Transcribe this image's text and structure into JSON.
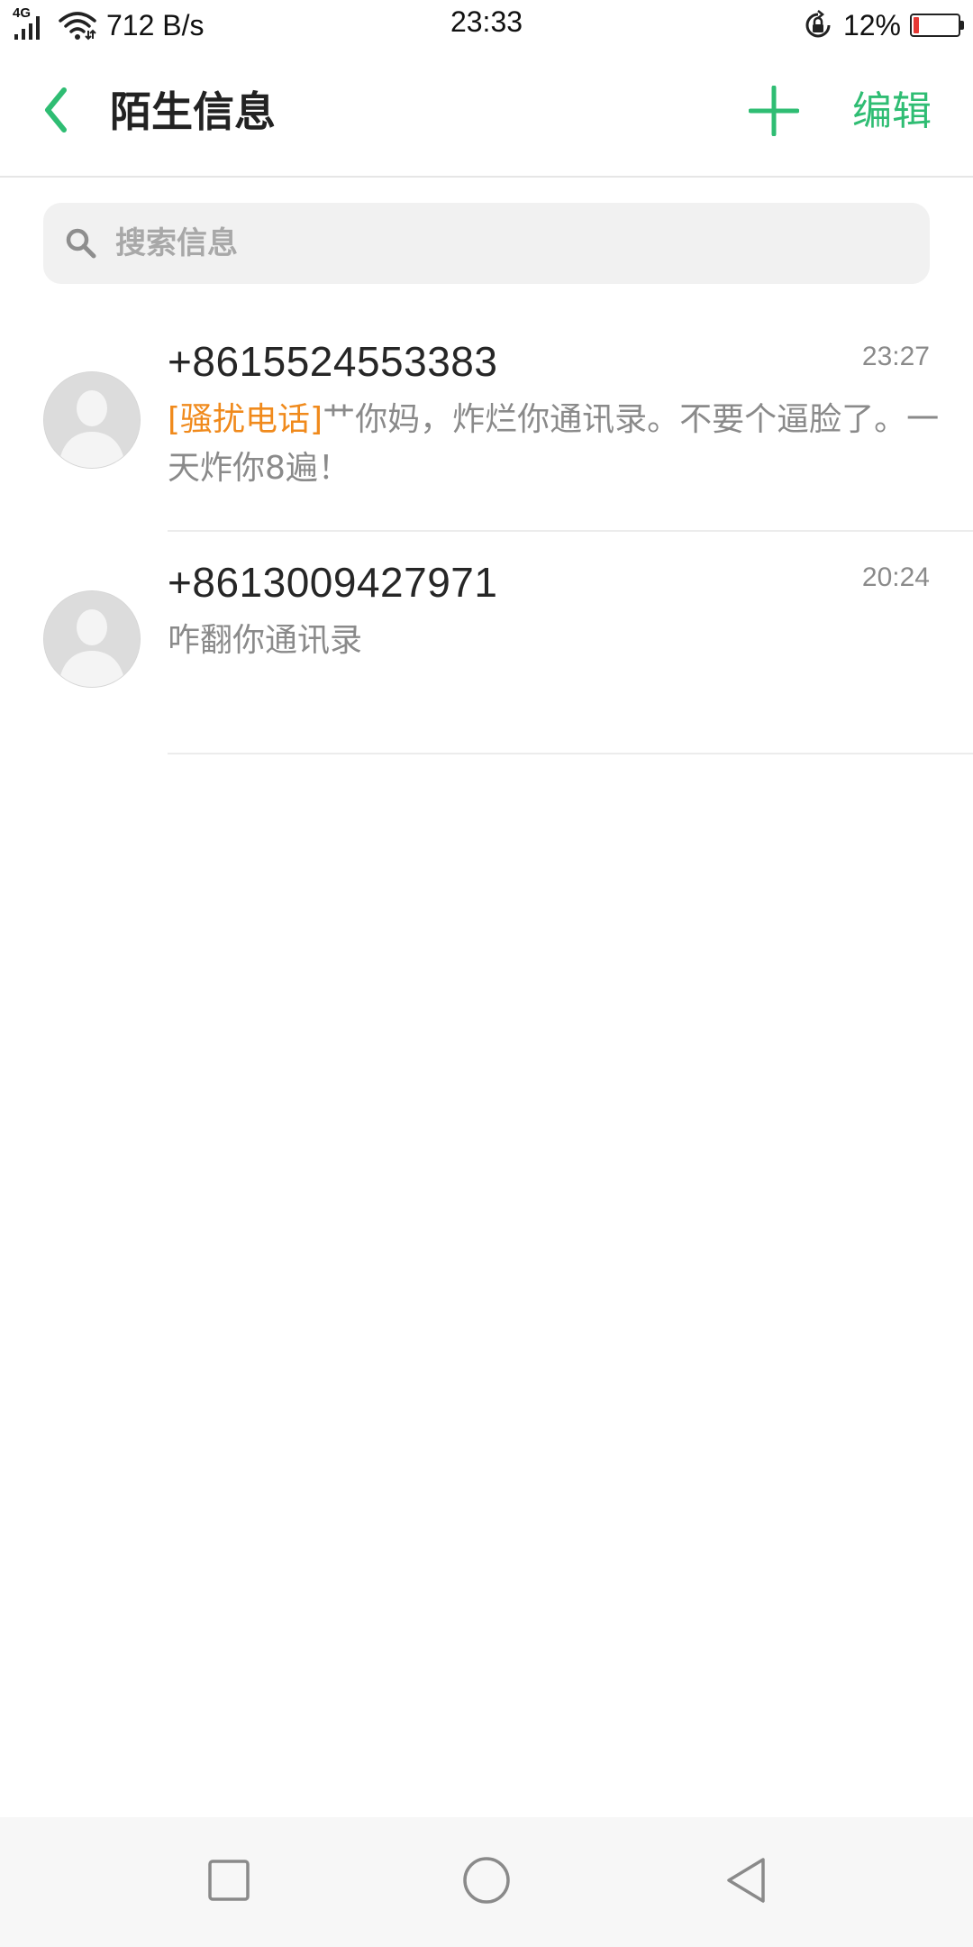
{
  "status_bar": {
    "network_type": "4G",
    "net_speed": "712 B/s",
    "time": "23:33",
    "battery_percent": "12%",
    "battery_level": 0.12
  },
  "header": {
    "title": "陌生信息",
    "edit_label": "编辑",
    "accent_color": "#2fbd73"
  },
  "search": {
    "placeholder": "搜索信息"
  },
  "conversations": [
    {
      "name": "+8615524553383",
      "time": "23:27",
      "tag": "[骚扰电话]",
      "snippet": "艹你妈，炸烂你通讯录。不要个逼脸了。一天炸你8遍！"
    },
    {
      "name": "+8613009427971",
      "time": "20:24",
      "tag": "",
      "snippet": "咋翻你通讯录"
    }
  ],
  "icons": {
    "back": "chevron-left-icon",
    "add": "plus-icon",
    "search": "search-icon",
    "avatar": "person-silhouette-icon",
    "nav_recent": "square-icon",
    "nav_home": "circle-icon",
    "nav_back": "triangle-back-icon"
  }
}
